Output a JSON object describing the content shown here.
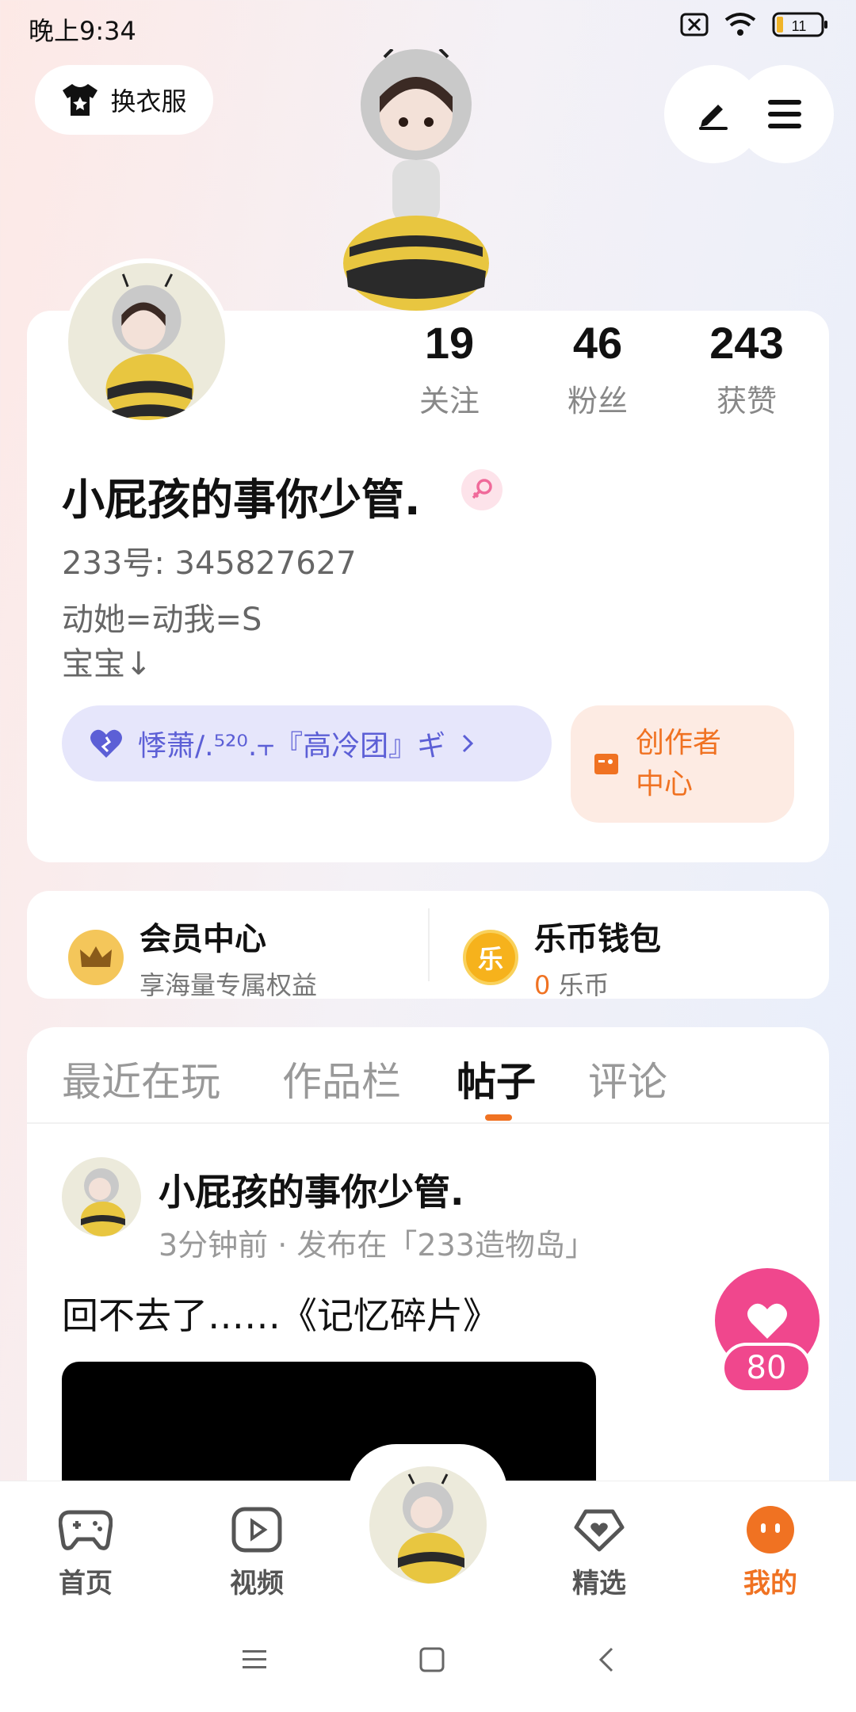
{
  "status_bar": {
    "time": "晚上9:34",
    "battery": "11"
  },
  "top": {
    "outfit_label": "换衣服"
  },
  "stats": [
    {
      "value": "19",
      "label": "关注"
    },
    {
      "value": "46",
      "label": "粉丝"
    },
    {
      "value": "243",
      "label": "获赞"
    }
  ],
  "profile": {
    "username": "小屁孩的事你少管.",
    "uid": "233号: 345827627",
    "bio_line1": "动她=动我=S",
    "bio_line2": "宝宝↓",
    "group_label": "悸萧/.⁵²⁰.⫟『高冷团』ギ",
    "creator_line1": "创作者",
    "creator_line2": "中心"
  },
  "member": {
    "title": "会员中心",
    "subtitle": "享海量专属权益",
    "icon_char": "♛"
  },
  "wallet": {
    "title": "乐币钱包",
    "amount": "0",
    "unit": "乐币",
    "icon_char": "乐"
  },
  "tabs": [
    {
      "label": "最近在玩",
      "active": false
    },
    {
      "label": "作品栏",
      "active": false
    },
    {
      "label": "帖子",
      "active": true
    },
    {
      "label": "评论",
      "active": false
    }
  ],
  "post": {
    "author": "小屁孩的事你少管.",
    "meta": "3分钟前 · 发布在「233造物岛」",
    "text": "回不去了……《记忆碎片》",
    "likes": "80"
  },
  "nav": [
    {
      "label": "首页",
      "icon": "gamepad-icon"
    },
    {
      "label": "视频",
      "icon": "play-icon"
    },
    {
      "label": "精选",
      "icon": "heart-box-icon"
    },
    {
      "label": "我的",
      "icon": "smile-icon"
    }
  ],
  "colors": {
    "accent": "#f07222",
    "like": "#f0478d",
    "group": "#5c5fd6"
  }
}
